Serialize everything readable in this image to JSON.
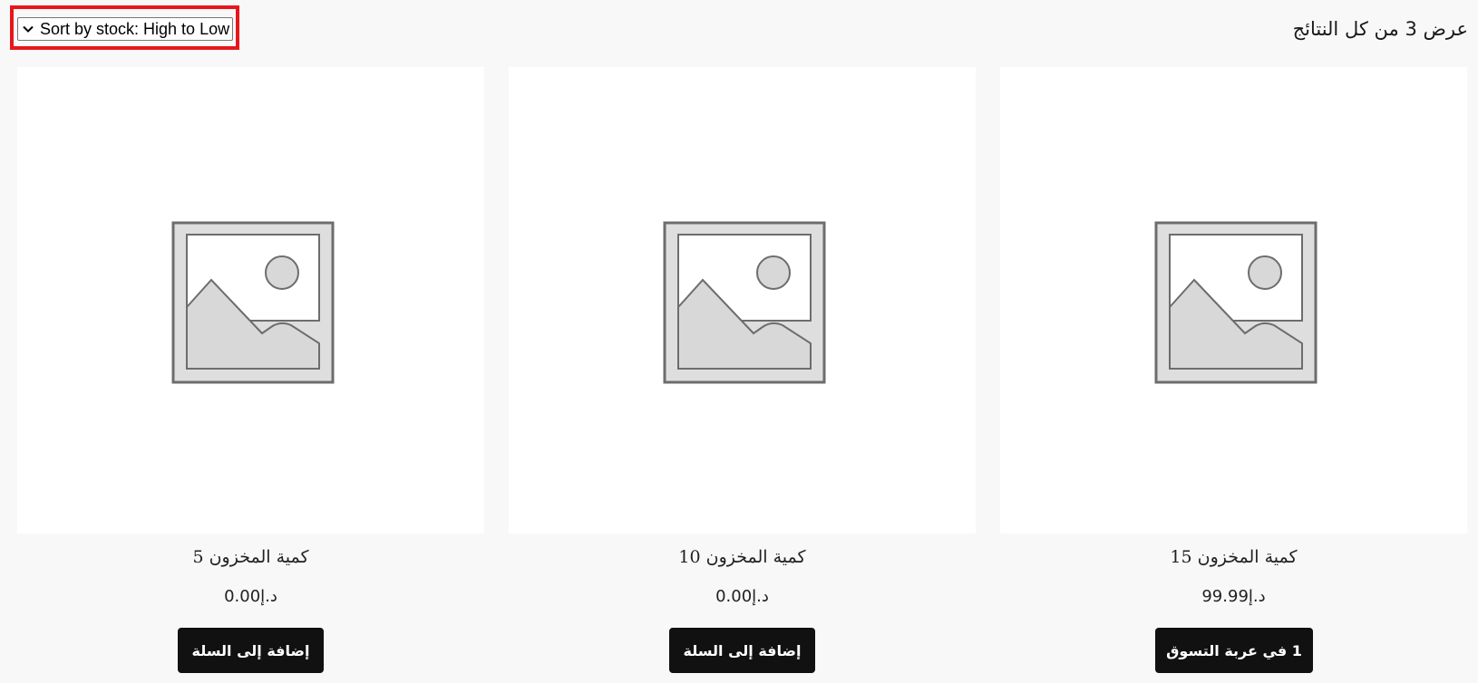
{
  "toolbar": {
    "sort_label": "Sort by stock: High to Low",
    "results_text": "عرض 3 من كل النتائج",
    "highlight_color": "#e8161b"
  },
  "products": [
    {
      "title": "كمية المخزون 5",
      "price": "0.00د.إ",
      "button": "إضافة إلى السلة",
      "image_icon": "placeholder-image-icon"
    },
    {
      "title": "كمية المخزون 10",
      "price": "0.00د.إ",
      "button": "إضافة إلى السلة",
      "image_icon": "placeholder-image-icon"
    },
    {
      "title": "كمية المخزون 15",
      "price": "99.99د.إ",
      "button": "1 في عربة التسوق",
      "image_icon": "placeholder-image-icon"
    }
  ]
}
